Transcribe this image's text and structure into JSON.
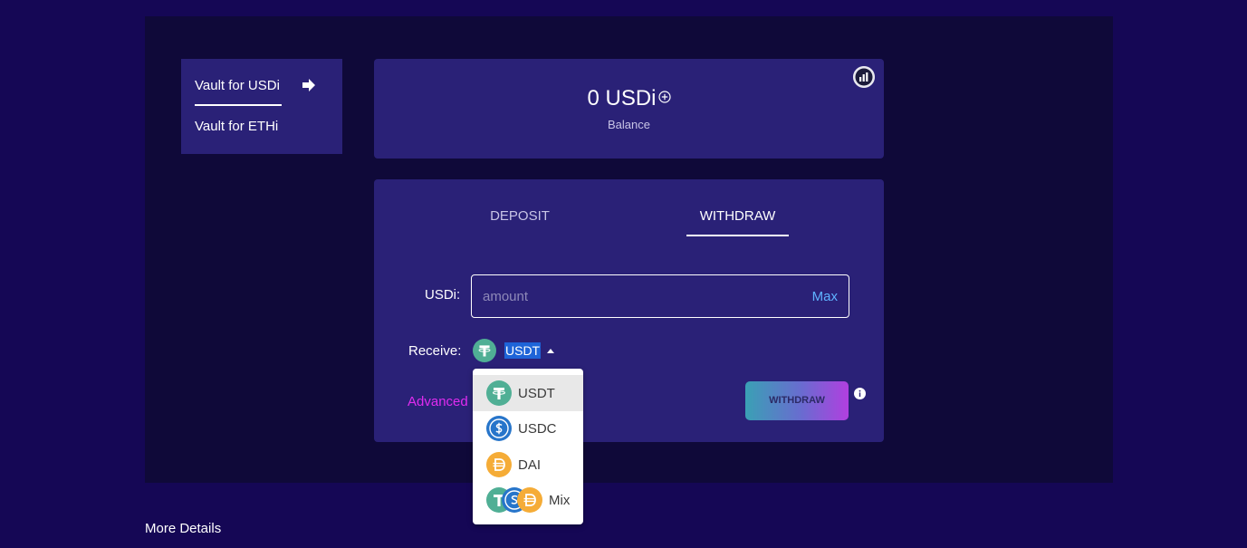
{
  "sidebar": {
    "items": [
      {
        "label": "Vault for USDi",
        "active": true
      },
      {
        "label": "Vault for ETHi",
        "active": false
      }
    ]
  },
  "balance": {
    "value": "0 USDi",
    "label": "Balance"
  },
  "tabs": {
    "deposit": "DEPOSIT",
    "withdraw": "WITHDRAW",
    "active": "WITHDRAW"
  },
  "form": {
    "amount_label": "USDi:",
    "amount_placeholder": "amount",
    "amount_value": "",
    "max_label": "Max",
    "receive_label": "Receive:",
    "receive_value": "USDT",
    "advanced_label": "Advanced",
    "withdraw_button": "WITHDRAW"
  },
  "dropdown": {
    "options": [
      {
        "label": "USDT",
        "icon": "usdt-icon",
        "selected": true
      },
      {
        "label": "USDC",
        "icon": "usdc-icon",
        "selected": false
      },
      {
        "label": "DAI",
        "icon": "dai-icon",
        "selected": false
      },
      {
        "label": "Mix",
        "icon": "mix-icon",
        "selected": false
      }
    ]
  },
  "footer": {
    "more_details": "More Details"
  },
  "colors": {
    "page_bg": "#150755",
    "panel_bg": "#0f0939",
    "card_bg": "#2a2177",
    "accent_link": "#5fb2ff",
    "advanced": "#e02cf0",
    "usdt": "#50af95",
    "usdc": "#2775ca",
    "dai": "#f5ac37"
  }
}
